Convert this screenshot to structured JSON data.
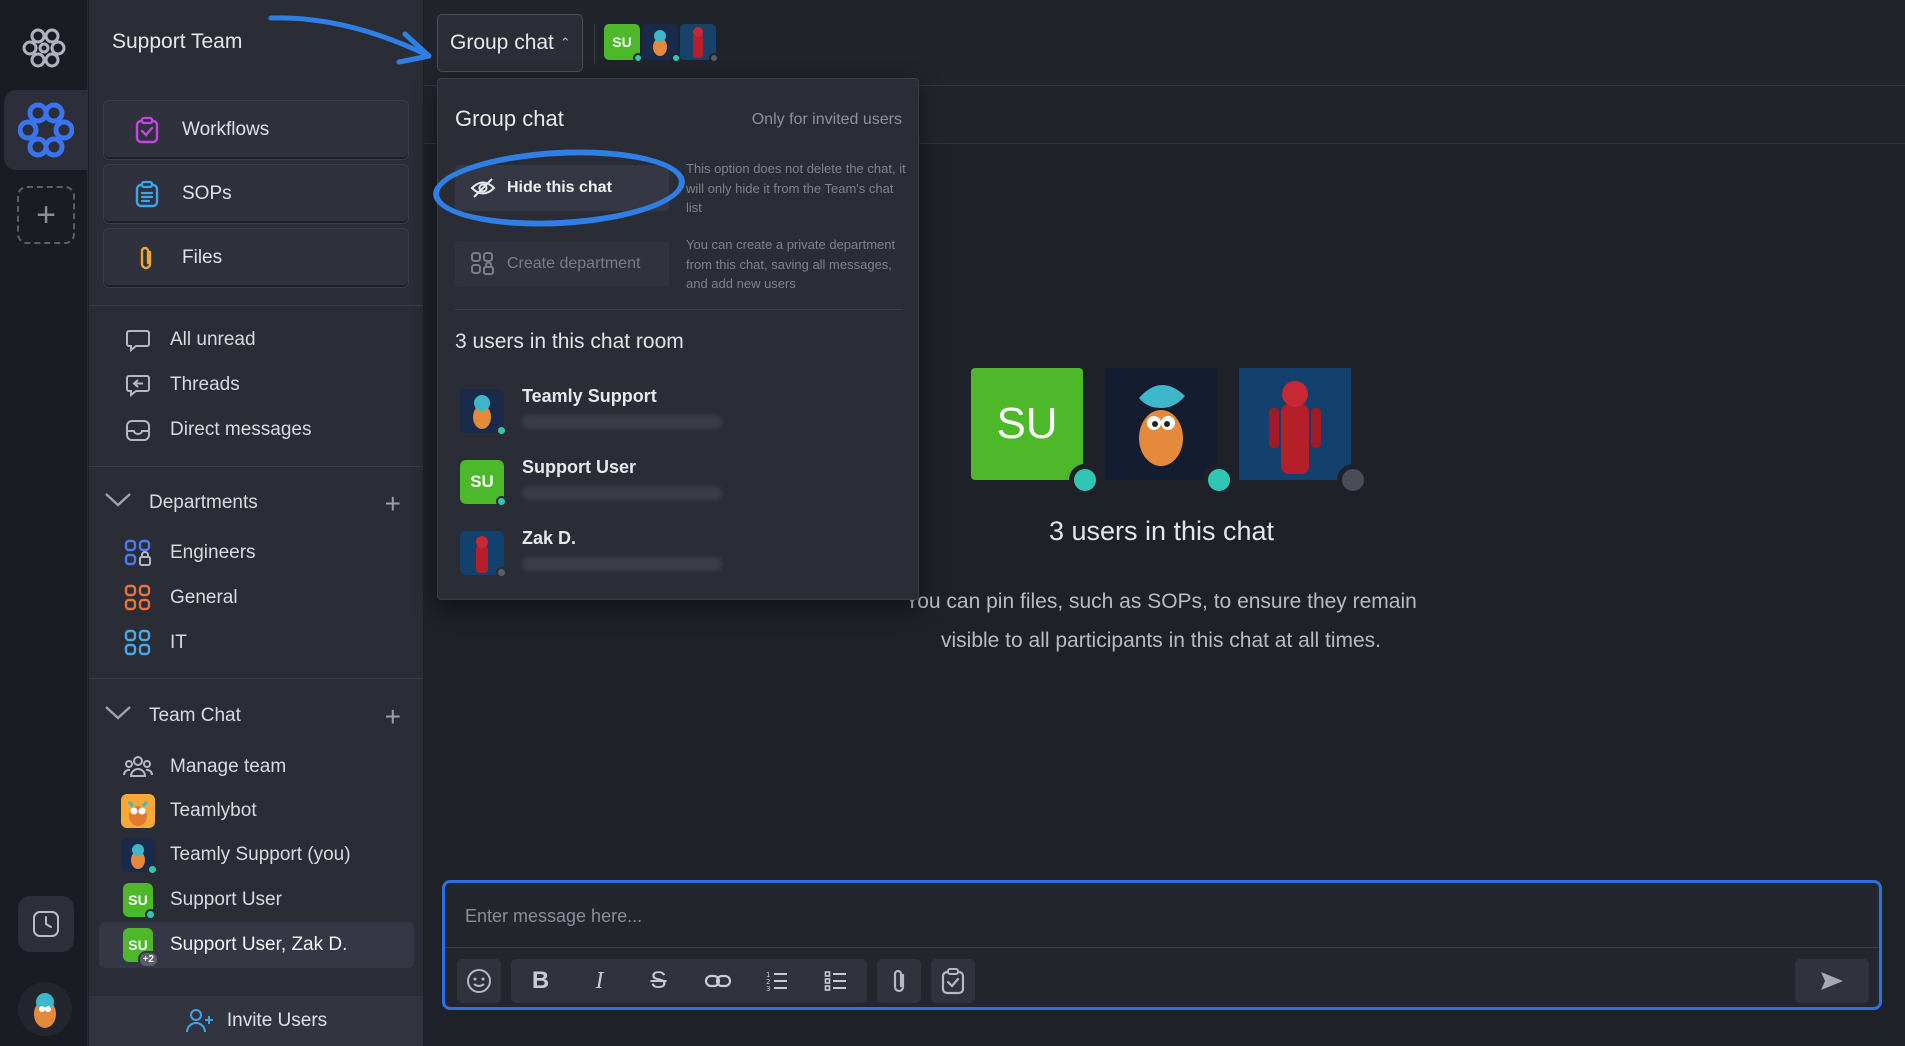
{
  "rail": {
    "logo_icon": "flower-logo-icon",
    "add_icon": "plus-icon",
    "history_icon": "clock-icon"
  },
  "sidebar": {
    "team_name": "Support Team",
    "cards": [
      {
        "label": "Workflows",
        "icon": "clipboard-check-icon"
      },
      {
        "label": "SOPs",
        "icon": "list-icon"
      },
      {
        "label": "Files",
        "icon": "paperclip-icon"
      }
    ],
    "nav": [
      {
        "label": "All unread",
        "icon": "chat-bubble-icon"
      },
      {
        "label": "Threads",
        "icon": "threads-icon"
      },
      {
        "label": "Direct messages",
        "icon": "inbox-icon"
      }
    ],
    "departments": {
      "title": "Departments",
      "items": [
        {
          "label": "Engineers",
          "color": "#4b7bec"
        },
        {
          "label": "General",
          "color": "#e8743b"
        },
        {
          "label": "IT",
          "color": "#4aa8e8"
        }
      ]
    },
    "team_chat": {
      "title": "Team Chat",
      "items": [
        {
          "label": "Manage team"
        },
        {
          "label": "Teamlybot"
        },
        {
          "label": "Teamly Support (you)"
        },
        {
          "label": "Support User",
          "initials": "SU"
        },
        {
          "label": "Support User, Zak D.",
          "initials": "SU",
          "badge": "+2"
        }
      ]
    },
    "invite_label": "Invite Users"
  },
  "header": {
    "chat_button_label": "Group chat",
    "avatar_initials": "SU"
  },
  "dropdown": {
    "title": "Group chat",
    "note": "Only for invited users",
    "hide_label": "Hide this chat",
    "hide_desc": "This option does not delete the chat, it will only hide it from the Team's chat list",
    "dept_label": "Create department",
    "dept_desc": "You can create a private department from this chat, saving all messages, and add new users",
    "users_title": "3 users in this chat room",
    "users": [
      {
        "name": "Teamly Support",
        "status": "online"
      },
      {
        "name": "Support User",
        "initials": "SU",
        "status": "online"
      },
      {
        "name": "Zak D.",
        "status": "offline"
      }
    ]
  },
  "center": {
    "initials": "SU",
    "title": "3 users in this chat",
    "text": "You can pin files, such as SOPs, to ensure they remain visible to all participants in this chat at all times."
  },
  "composer": {
    "placeholder": "Enter message here..."
  },
  "colors": {
    "accent": "#2f80e6",
    "online": "#2fc6b4",
    "su_green": "#4cb82a",
    "background": "#1f2129"
  }
}
